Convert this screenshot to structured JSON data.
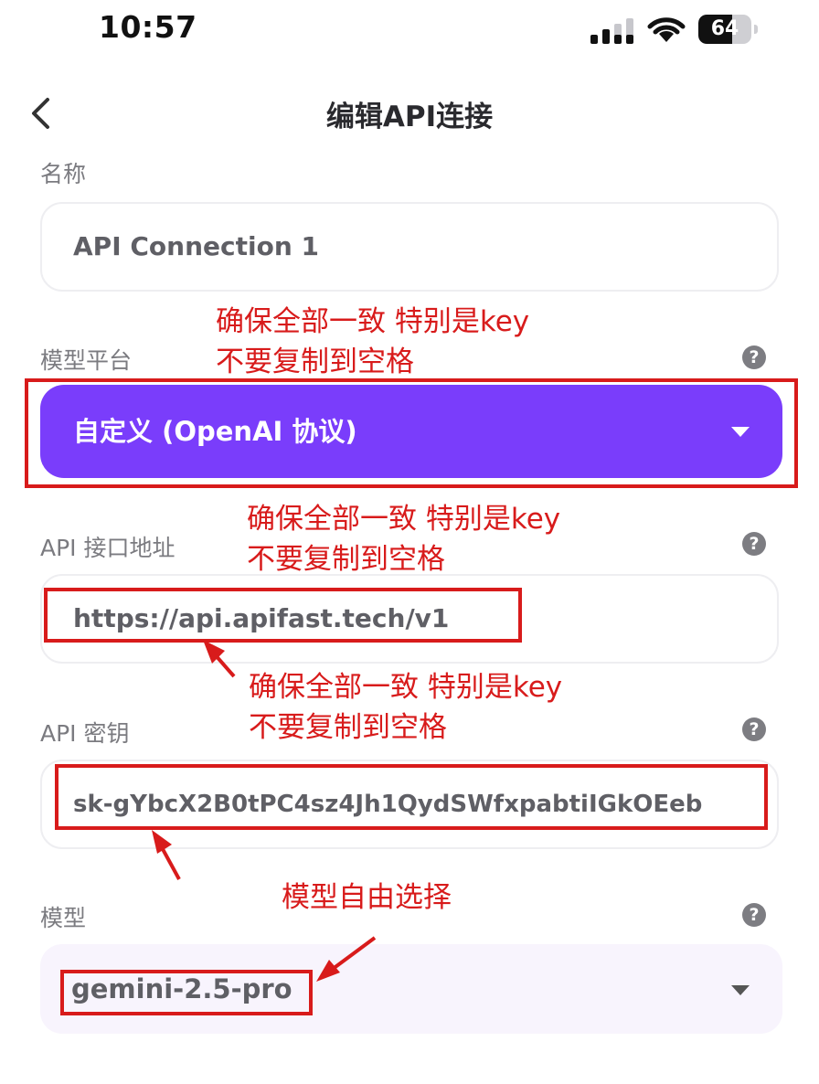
{
  "status_bar": {
    "time": "10:57",
    "battery": 64,
    "battery_label": "64"
  },
  "nav": {
    "title": "编辑API连接"
  },
  "form": {
    "name_label": "名称",
    "name_value": "API Connection 1",
    "platform_label": "模型平台",
    "platform_value": "自定义 (OpenAI 协议)",
    "endpoint_label": "API 接口地址",
    "endpoint_value": "https://api.apifast.tech/v1",
    "key_label": "API 密钥",
    "key_value": "sk-gYbcX2B0tPC4sz4Jh1QydSWfxpabtiIGkOEeb",
    "model_label": "模型",
    "model_value": "gemini-2.5-pro",
    "help_glyph": "?"
  },
  "annotations": {
    "note_line1": "确保全部一致 特别是key",
    "note_line2": "不要复制到空格",
    "model_note": "模型自由选择"
  },
  "colors": {
    "accent": "#7a3dfb",
    "annotation": "#d81b1b"
  }
}
